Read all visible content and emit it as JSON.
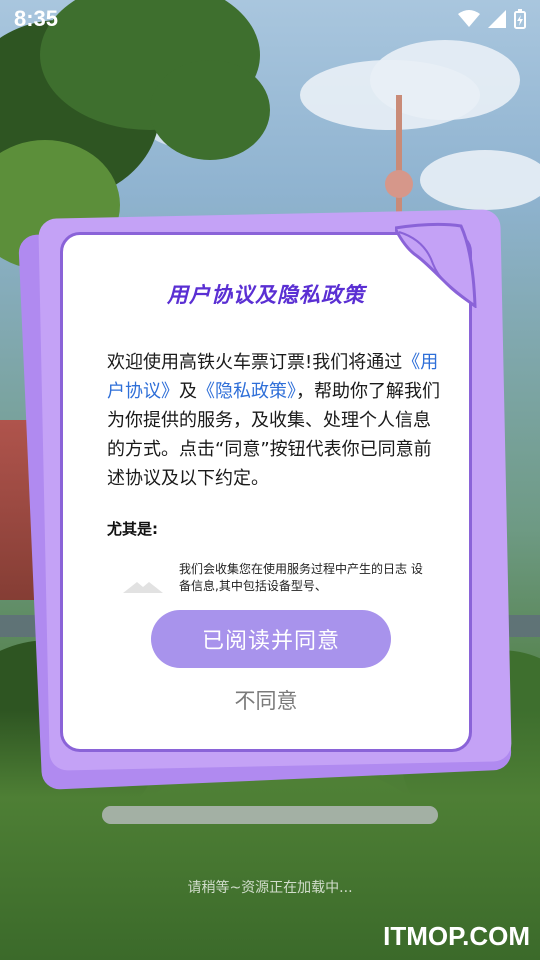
{
  "status_bar": {
    "time": "8:35"
  },
  "dialog": {
    "title": "用户协议及隐私政策",
    "intro_1": "欢迎使用高铁火车票订票!我们将通过",
    "user_agreement_link": "《用户协议》",
    "and": "及",
    "privacy_policy_link": "《隐私政策》",
    "intro_2": "，帮助你了解我们为你提供的服务，及收集、处理个人信息的方式。点击“同意”按钮代表你已同意前述协议及以下约定。",
    "section_head": "尤其是:",
    "detail_text": "我们会收集您在使用服务过程中产生的日志 设备信息,其中包括设备型号、",
    "agree_label": "已阅读并同意",
    "disagree_label": "不同意"
  },
  "loading": {
    "text": "请稍等~资源正在加载中...",
    "progress": 1.0
  },
  "watermark": "ITMOP.COM",
  "colors": {
    "accent": "#8a63d8",
    "agree_button": "#a893ec",
    "title": "#5a2fd3",
    "link": "#2f6fd8"
  }
}
